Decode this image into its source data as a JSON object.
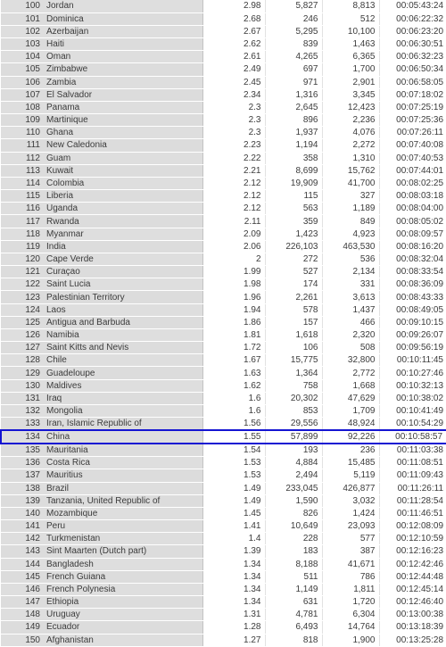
{
  "table": {
    "selected_row_rank": 134,
    "selected_highlight_color": "#1414d2",
    "row_background": "#dedede",
    "value_background": "#ffffff",
    "text_color": "#3b3b3b",
    "columns": [
      {
        "key": "rank",
        "align": "right"
      },
      {
        "key": "country",
        "align": "left"
      },
      {
        "key": "value1",
        "align": "right"
      },
      {
        "key": "value2",
        "align": "right"
      },
      {
        "key": "value3",
        "align": "right"
      },
      {
        "key": "time",
        "align": "right"
      }
    ],
    "rows": [
      {
        "rank": "100",
        "country": "Jordan",
        "value1": "2.98",
        "value2": "5,827",
        "value3": "8,813",
        "time": "00:05:43:24"
      },
      {
        "rank": "101",
        "country": "Dominica",
        "value1": "2.68",
        "value2": "246",
        "value3": "512",
        "time": "00:06:22:32"
      },
      {
        "rank": "102",
        "country": "Azerbaijan",
        "value1": "2.67",
        "value2": "5,295",
        "value3": "10,100",
        "time": "00:06:23:20"
      },
      {
        "rank": "103",
        "country": "Haiti",
        "value1": "2.62",
        "value2": "839",
        "value3": "1,463",
        "time": "00:06:30:51"
      },
      {
        "rank": "104",
        "country": "Oman",
        "value1": "2.61",
        "value2": "4,265",
        "value3": "6,365",
        "time": "00:06:32:23"
      },
      {
        "rank": "105",
        "country": "Zimbabwe",
        "value1": "2.49",
        "value2": "697",
        "value3": "1,700",
        "time": "00:06:50:34"
      },
      {
        "rank": "106",
        "country": "Zambia",
        "value1": "2.45",
        "value2": "971",
        "value3": "2,901",
        "time": "00:06:58:05"
      },
      {
        "rank": "107",
        "country": "El Salvador",
        "value1": "2.34",
        "value2": "1,316",
        "value3": "3,345",
        "time": "00:07:18:02"
      },
      {
        "rank": "108",
        "country": "Panama",
        "value1": "2.3",
        "value2": "2,645",
        "value3": "12,423",
        "time": "00:07:25:19"
      },
      {
        "rank": "109",
        "country": "Martinique",
        "value1": "2.3",
        "value2": "896",
        "value3": "2,236",
        "time": "00:07:25:36"
      },
      {
        "rank": "110",
        "country": "Ghana",
        "value1": "2.3",
        "value2": "1,937",
        "value3": "4,076",
        "time": "00:07:26:11"
      },
      {
        "rank": "111",
        "country": "New Caledonia",
        "value1": "2.23",
        "value2": "1,194",
        "value3": "2,272",
        "time": "00:07:40:08"
      },
      {
        "rank": "112",
        "country": "Guam",
        "value1": "2.22",
        "value2": "358",
        "value3": "1,310",
        "time": "00:07:40:53"
      },
      {
        "rank": "113",
        "country": "Kuwait",
        "value1": "2.21",
        "value2": "8,699",
        "value3": "15,762",
        "time": "00:07:44:01"
      },
      {
        "rank": "114",
        "country": "Colombia",
        "value1": "2.12",
        "value2": "19,909",
        "value3": "41,700",
        "time": "00:08:02:25"
      },
      {
        "rank": "115",
        "country": "Liberia",
        "value1": "2.12",
        "value2": "115",
        "value3": "327",
        "time": "00:08:03:18"
      },
      {
        "rank": "116",
        "country": "Uganda",
        "value1": "2.12",
        "value2": "563",
        "value3": "1,189",
        "time": "00:08:04:00"
      },
      {
        "rank": "117",
        "country": "Rwanda",
        "value1": "2.11",
        "value2": "359",
        "value3": "849",
        "time": "00:08:05:02"
      },
      {
        "rank": "118",
        "country": "Myanmar",
        "value1": "2.09",
        "value2": "1,423",
        "value3": "4,923",
        "time": "00:08:09:57"
      },
      {
        "rank": "119",
        "country": "India",
        "value1": "2.06",
        "value2": "226,103",
        "value3": "463,530",
        "time": "00:08:16:20"
      },
      {
        "rank": "120",
        "country": "Cape Verde",
        "value1": "2",
        "value2": "272",
        "value3": "536",
        "time": "00:08:32:04"
      },
      {
        "rank": "121",
        "country": "Curaçao",
        "value1": "1.99",
        "value2": "527",
        "value3": "2,134",
        "time": "00:08:33:54"
      },
      {
        "rank": "122",
        "country": "Saint Lucia",
        "value1": "1.98",
        "value2": "174",
        "value3": "331",
        "time": "00:08:36:09"
      },
      {
        "rank": "123",
        "country": "Palestinian Territory",
        "value1": "1.96",
        "value2": "2,261",
        "value3": "3,613",
        "time": "00:08:43:33"
      },
      {
        "rank": "124",
        "country": "Laos",
        "value1": "1.94",
        "value2": "578",
        "value3": "1,437",
        "time": "00:08:49:05"
      },
      {
        "rank": "125",
        "country": "Antigua and Barbuda",
        "value1": "1.86",
        "value2": "157",
        "value3": "466",
        "time": "00:09:10:15"
      },
      {
        "rank": "126",
        "country": "Namibia",
        "value1": "1.81",
        "value2": "1,618",
        "value3": "2,320",
        "time": "00:09:26:07"
      },
      {
        "rank": "127",
        "country": "Saint Kitts and Nevis",
        "value1": "1.72",
        "value2": "106",
        "value3": "508",
        "time": "00:09:56:19"
      },
      {
        "rank": "128",
        "country": "Chile",
        "value1": "1.67",
        "value2": "15,775",
        "value3": "32,800",
        "time": "00:10:11:45"
      },
      {
        "rank": "129",
        "country": "Guadeloupe",
        "value1": "1.63",
        "value2": "1,364",
        "value3": "2,772",
        "time": "00:10:27:46"
      },
      {
        "rank": "130",
        "country": "Maldives",
        "value1": "1.62",
        "value2": "758",
        "value3": "1,668",
        "time": "00:10:32:13"
      },
      {
        "rank": "131",
        "country": "Iraq",
        "value1": "1.6",
        "value2": "20,302",
        "value3": "47,629",
        "time": "00:10:38:02"
      },
      {
        "rank": "132",
        "country": "Mongolia",
        "value1": "1.6",
        "value2": "853",
        "value3": "1,709",
        "time": "00:10:41:49"
      },
      {
        "rank": "133",
        "country": "Iran, Islamic Republic of",
        "value1": "1.56",
        "value2": "29,556",
        "value3": "48,924",
        "time": "00:10:54:29"
      },
      {
        "rank": "134",
        "country": "China",
        "value1": "1.55",
        "value2": "57,899",
        "value3": "92,226",
        "time": "00:10:58:57"
      },
      {
        "rank": "135",
        "country": "Mauritania",
        "value1": "1.54",
        "value2": "193",
        "value3": "236",
        "time": "00:11:03:38"
      },
      {
        "rank": "136",
        "country": "Costa Rica",
        "value1": "1.53",
        "value2": "4,884",
        "value3": "15,485",
        "time": "00:11:08:51"
      },
      {
        "rank": "137",
        "country": "Mauritius",
        "value1": "1.53",
        "value2": "2,494",
        "value3": "5,119",
        "time": "00:11:09:43"
      },
      {
        "rank": "138",
        "country": "Brazil",
        "value1": "1.49",
        "value2": "233,045",
        "value3": "426,877",
        "time": "00:11:26:11"
      },
      {
        "rank": "139",
        "country": "Tanzania, United Republic of",
        "value1": "1.49",
        "value2": "1,590",
        "value3": "3,032",
        "time": "00:11:28:54"
      },
      {
        "rank": "140",
        "country": "Mozambique",
        "value1": "1.45",
        "value2": "826",
        "value3": "1,424",
        "time": "00:11:46:51"
      },
      {
        "rank": "141",
        "country": "Peru",
        "value1": "1.41",
        "value2": "10,649",
        "value3": "23,093",
        "time": "00:12:08:09"
      },
      {
        "rank": "142",
        "country": "Turkmenistan",
        "value1": "1.4",
        "value2": "228",
        "value3": "577",
        "time": "00:12:10:59"
      },
      {
        "rank": "143",
        "country": "Sint Maarten (Dutch part)",
        "value1": "1.39",
        "value2": "183",
        "value3": "387",
        "time": "00:12:16:23"
      },
      {
        "rank": "144",
        "country": "Bangladesh",
        "value1": "1.34",
        "value2": "8,188",
        "value3": "41,671",
        "time": "00:12:42:46"
      },
      {
        "rank": "145",
        "country": "French Guiana",
        "value1": "1.34",
        "value2": "511",
        "value3": "786",
        "time": "00:12:44:48"
      },
      {
        "rank": "146",
        "country": "French Polynesia",
        "value1": "1.34",
        "value2": "1,149",
        "value3": "1,811",
        "time": "00:12:45:14"
      },
      {
        "rank": "147",
        "country": "Ethiopia",
        "value1": "1.34",
        "value2": "631",
        "value3": "1,720",
        "time": "00:12:46:40"
      },
      {
        "rank": "148",
        "country": "Uruguay",
        "value1": "1.31",
        "value2": "4,781",
        "value3": "6,304",
        "time": "00:13:00:38"
      },
      {
        "rank": "149",
        "country": "Ecuador",
        "value1": "1.28",
        "value2": "6,493",
        "value3": "14,764",
        "time": "00:13:18:39"
      },
      {
        "rank": "150",
        "country": "Afghanistan",
        "value1": "1.27",
        "value2": "818",
        "value3": "1,900",
        "time": "00:13:25:28"
      }
    ]
  }
}
